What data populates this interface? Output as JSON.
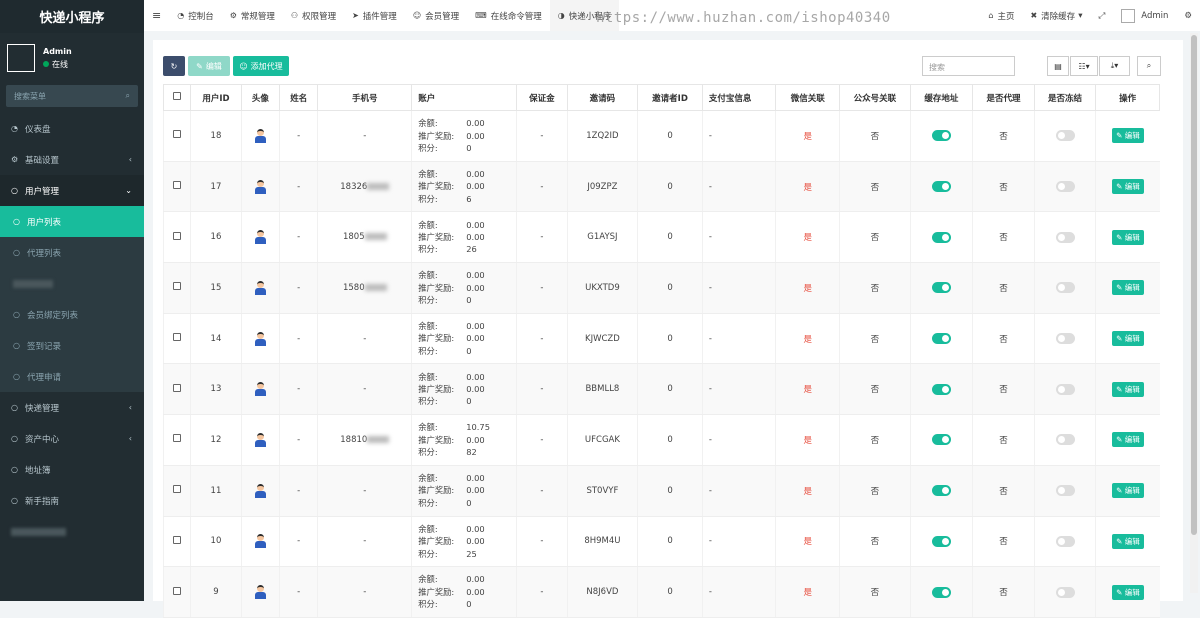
{
  "app": {
    "title": "快递小程序"
  },
  "user": {
    "name": "Admin",
    "status": "在线"
  },
  "sidebar": {
    "search_placeholder": "搜索菜单",
    "items": [
      {
        "label": "仪表盘"
      },
      {
        "label": "基础设置"
      },
      {
        "label": "用户管理"
      },
      {
        "label": "快递管理"
      },
      {
        "label": "资产中心"
      },
      {
        "label": "地址簿"
      },
      {
        "label": "新手指南"
      }
    ],
    "sub_items": [
      {
        "label": "用户列表"
      },
      {
        "label": "代理列表"
      },
      {
        "label": ""
      },
      {
        "label": "会员绑定列表"
      },
      {
        "label": "签到记录"
      },
      {
        "label": "代理申请"
      }
    ]
  },
  "topbar": {
    "tabs": [
      {
        "label": "控制台"
      },
      {
        "label": "常规管理"
      },
      {
        "label": "权限管理"
      },
      {
        "label": "插件管理"
      },
      {
        "label": "会员管理"
      },
      {
        "label": "在线命令管理"
      },
      {
        "label": "快递小程序"
      }
    ],
    "home": "主页",
    "clear_cache": "清除缓存",
    "admin": "Admin",
    "watermark": "https://www.huzhan.com/ishop40340"
  },
  "toolbar": {
    "edit": "编辑",
    "add_agent": "添加代理",
    "search_placeholder": "搜索"
  },
  "table": {
    "headers": [
      "用户ID",
      "头像",
      "姓名",
      "手机号",
      "账户",
      "保证金",
      "邀请码",
      "邀请者ID",
      "支付宝信息",
      "微信关联",
      "公众号关联",
      "缓存地址",
      "是否代理",
      "是否冻结",
      "操作"
    ],
    "account_labels": {
      "balance": "余额:",
      "reward": "推广奖励:",
      "points": "积分:"
    },
    "edit_label": "编辑",
    "rows": [
      {
        "id": "18",
        "name": "-",
        "phone": "-",
        "balance": "0.00",
        "reward": "0.00",
        "points": "0",
        "deposit": "-",
        "code": "1ZQ2ID",
        "inviter": "0",
        "alipay": "-",
        "wechat": "是",
        "mp": "否",
        "agent": "否"
      },
      {
        "id": "17",
        "name": "-",
        "phone": "18326",
        "balance": "0.00",
        "reward": "0.00",
        "points": "6",
        "deposit": "-",
        "code": "J09ZPZ",
        "inviter": "0",
        "alipay": "-",
        "wechat": "是",
        "mp": "否",
        "agent": "否"
      },
      {
        "id": "16",
        "name": "-",
        "phone": "1805",
        "balance": "0.00",
        "reward": "0.00",
        "points": "26",
        "deposit": "-",
        "code": "G1AYSJ",
        "inviter": "0",
        "alipay": "-",
        "wechat": "是",
        "mp": "否",
        "agent": "否"
      },
      {
        "id": "15",
        "name": "-",
        "phone": "1580",
        "balance": "0.00",
        "reward": "0.00",
        "points": "0",
        "deposit": "-",
        "code": "UKXTD9",
        "inviter": "0",
        "alipay": "-",
        "wechat": "是",
        "mp": "否",
        "agent": "否"
      },
      {
        "id": "14",
        "name": "-",
        "phone": "-",
        "balance": "0.00",
        "reward": "0.00",
        "points": "0",
        "deposit": "-",
        "code": "KJWCZD",
        "inviter": "0",
        "alipay": "-",
        "wechat": "是",
        "mp": "否",
        "agent": "否"
      },
      {
        "id": "13",
        "name": "-",
        "phone": "-",
        "balance": "0.00",
        "reward": "0.00",
        "points": "0",
        "deposit": "-",
        "code": "BBMLL8",
        "inviter": "0",
        "alipay": "-",
        "wechat": "是",
        "mp": "否",
        "agent": "否"
      },
      {
        "id": "12",
        "name": "-",
        "phone": "18810",
        "balance": "10.75",
        "reward": "0.00",
        "points": "82",
        "deposit": "-",
        "code": "UFCGAK",
        "inviter": "0",
        "alipay": "-",
        "wechat": "是",
        "mp": "否",
        "agent": "否"
      },
      {
        "id": "11",
        "name": "-",
        "phone": "-",
        "balance": "0.00",
        "reward": "0.00",
        "points": "0",
        "deposit": "-",
        "code": "ST0VYF",
        "inviter": "0",
        "alipay": "-",
        "wechat": "是",
        "mp": "否",
        "agent": "否"
      },
      {
        "id": "10",
        "name": "-",
        "phone": "-",
        "balance": "0.00",
        "reward": "0.00",
        "points": "25",
        "deposit": "-",
        "code": "8H9M4U",
        "inviter": "0",
        "alipay": "-",
        "wechat": "是",
        "mp": "否",
        "agent": "否"
      },
      {
        "id": "9",
        "name": "-",
        "phone": "-",
        "balance": "0.00",
        "reward": "0.00",
        "points": "0",
        "deposit": "-",
        "code": "N8J6VD",
        "inviter": "0",
        "alipay": "-",
        "wechat": "是",
        "mp": "否",
        "agent": "否"
      }
    ]
  }
}
